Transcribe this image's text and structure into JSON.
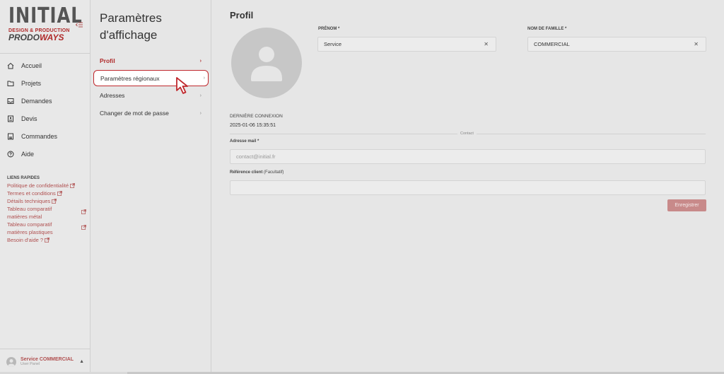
{
  "sidebar": {
    "logo": {
      "initial": "INITIAL",
      "sub": "DESIGN & PRODUCTION",
      "prod_a": "PRODO",
      "prod_b": "WAYS"
    },
    "items": [
      {
        "label": "Accueil",
        "icon": "home-icon"
      },
      {
        "label": "Projets",
        "icon": "folder-icon"
      },
      {
        "label": "Demandes",
        "icon": "inbox-icon"
      },
      {
        "label": "Devis",
        "icon": "quote-icon"
      },
      {
        "label": "Commandes",
        "icon": "order-icon"
      },
      {
        "label": "Aide",
        "icon": "help-icon"
      }
    ],
    "quick_links": {
      "title": "LIENS RAPIDES",
      "links": [
        "Politique de confidentialité",
        "Termes et conditions",
        "Détails techniques",
        "Tableau comparatif matières métal",
        "Tableau comparatif matières plastiques",
        "Besoin d'aide ?"
      ]
    },
    "user": {
      "name": "Service COMMERCIAL",
      "role": "User Panel"
    }
  },
  "settings": {
    "title": "Paramètres d'affichage",
    "items": [
      {
        "label": "Profil",
        "active": true
      },
      {
        "label": "Paramètres régionaux",
        "highlighted": true
      },
      {
        "label": "Adresses"
      },
      {
        "label": "Changer de mot de passe"
      }
    ]
  },
  "profile": {
    "title": "Profil",
    "first_name_label": "PRÉNOM *",
    "first_name_value": "Service",
    "last_name_label": "NOM DE FAMILLE *",
    "last_name_value": "COMMERCIAL",
    "last_login_label": "DERNIÈRE CONNEXION",
    "last_login_value": "2025-01-06 15:35:51",
    "contact_divider": "Contact",
    "email_label": "Adresse mail *",
    "email_value": "contact@initial.fr",
    "ref_label": "Référence client",
    "ref_optional": "(Facultatif)",
    "ref_value": "",
    "save_label": "Enregistrer"
  },
  "colors": {
    "accent": "#b02a2a",
    "highlight_border": "#c0282d",
    "button": "#c88a8a"
  }
}
